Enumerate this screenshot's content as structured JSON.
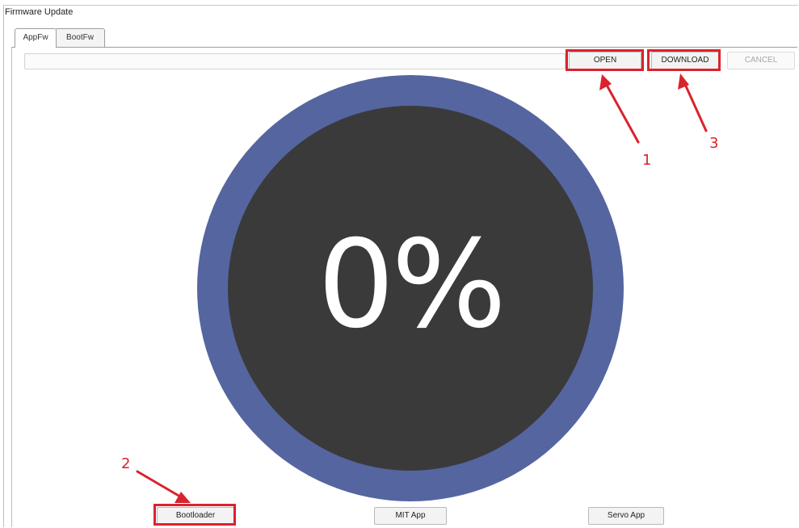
{
  "window": {
    "title": "Firmware Update"
  },
  "tabs": [
    {
      "label": "AppFw",
      "active": true
    },
    {
      "label": "BootFw",
      "active": false
    }
  ],
  "toolbar": {
    "path_value": "",
    "open_label": "OPEN",
    "download_label": "DOWNLOAD",
    "cancel_label": "CANCEL",
    "cancel_enabled": false
  },
  "progress": {
    "text": "0%",
    "value": 0,
    "ring_color": "#5565a0",
    "center_color": "#3a3a3a"
  },
  "mode_buttons": {
    "bootloader_label": "Bootloader",
    "mit_app_label": "MIT App",
    "servo_app_label": "Servo App"
  },
  "annotations": {
    "color": "#d9232d",
    "steps": [
      "1",
      "2",
      "3"
    ]
  }
}
